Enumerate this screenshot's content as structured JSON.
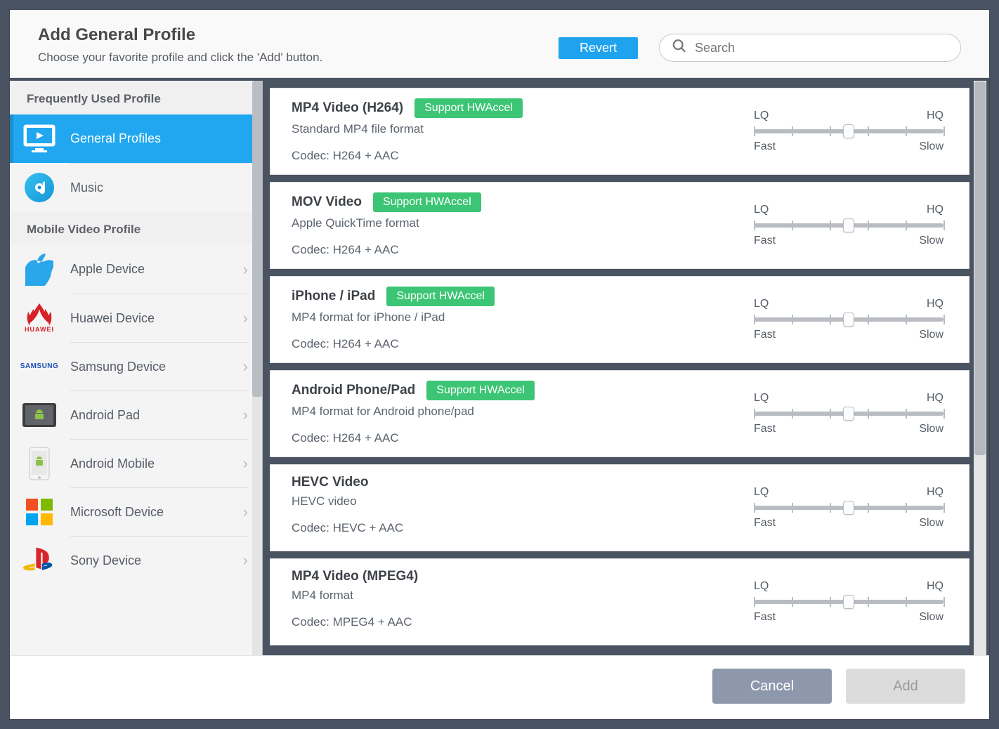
{
  "header": {
    "title": "Add General Profile",
    "subtitle": "Choose your favorite profile and click the 'Add' button.",
    "revert": "Revert",
    "search_placeholder": "Search"
  },
  "sidebar": {
    "section_a": "Frequently Used Profile",
    "section_b": "Mobile Video Profile",
    "freq": [
      {
        "label": "General Profiles",
        "icon": "monitor"
      },
      {
        "label": "Music",
        "icon": "disc"
      }
    ],
    "mobile": [
      {
        "label": "Apple Device",
        "icon": "apple"
      },
      {
        "label": "Huawei Device",
        "icon": "huawei"
      },
      {
        "label": "Samsung Device",
        "icon": "samsung"
      },
      {
        "label": "Android Pad",
        "icon": "android-pad"
      },
      {
        "label": "Android Mobile",
        "icon": "android-phone"
      },
      {
        "label": "Microsoft Device",
        "icon": "windows"
      },
      {
        "label": "Sony Device",
        "icon": "playstation"
      }
    ]
  },
  "slider": {
    "lq": "LQ",
    "hq": "HQ",
    "fast": "Fast",
    "slow": "Slow"
  },
  "hw_badge": "Support HWAccel",
  "profiles": [
    {
      "title": "MP4 Video (H264)",
      "hw": true,
      "desc": "Standard MP4 file format",
      "codec": "Codec: H264 + AAC"
    },
    {
      "title": "MOV Video",
      "hw": true,
      "desc": "Apple QuickTime format",
      "codec": "Codec: H264 + AAC"
    },
    {
      "title": "iPhone / iPad",
      "hw": true,
      "desc": "MP4 format for iPhone / iPad",
      "codec": "Codec: H264 + AAC"
    },
    {
      "title": "Android Phone/Pad",
      "hw": true,
      "desc": "MP4 format for Android phone/pad",
      "codec": "Codec: H264 + AAC"
    },
    {
      "title": "HEVC Video",
      "hw": false,
      "desc": "HEVC video",
      "codec": "Codec: HEVC + AAC"
    },
    {
      "title": "MP4 Video (MPEG4)",
      "hw": false,
      "desc": "MP4 format",
      "codec": "Codec: MPEG4 + AAC"
    }
  ],
  "footer": {
    "cancel": "Cancel",
    "add": "Add"
  }
}
